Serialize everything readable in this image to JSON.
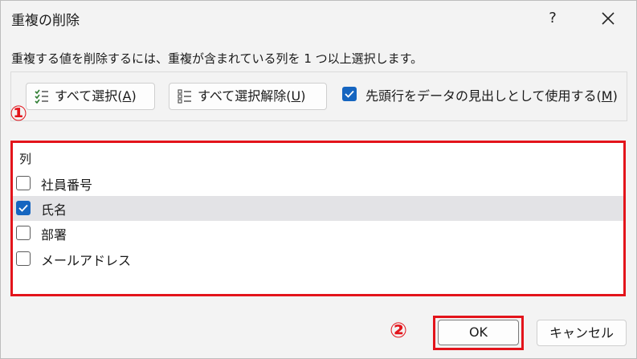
{
  "window": {
    "title": "重複の削除",
    "help_label": "?"
  },
  "instruction": "重複する値を削除するには、重複が含まれている列を 1 つ以上選択します。",
  "toolbar": {
    "select_all": {
      "text": "すべて選択(",
      "key": "A",
      "end": ")"
    },
    "deselect_all": {
      "text": "すべて選択解除(",
      "key": "U",
      "end": ")"
    },
    "headers": {
      "text": "先頭行をデータの見出しとして使用する(",
      "key": "M",
      "end": ")",
      "checked": true
    }
  },
  "annotations": {
    "marker1": "①",
    "marker2": "②",
    "highlight_color": "#e3141b"
  },
  "columns": {
    "header": "列",
    "items": [
      {
        "label": "社員番号",
        "checked": false
      },
      {
        "label": "氏名",
        "checked": true
      },
      {
        "label": "部署",
        "checked": false
      },
      {
        "label": "メールアドレス",
        "checked": false
      }
    ]
  },
  "buttons": {
    "ok": "OK",
    "cancel": "キャンセル"
  },
  "colors": {
    "accent": "#1565c0",
    "selected_row": "#e3e3e6"
  }
}
